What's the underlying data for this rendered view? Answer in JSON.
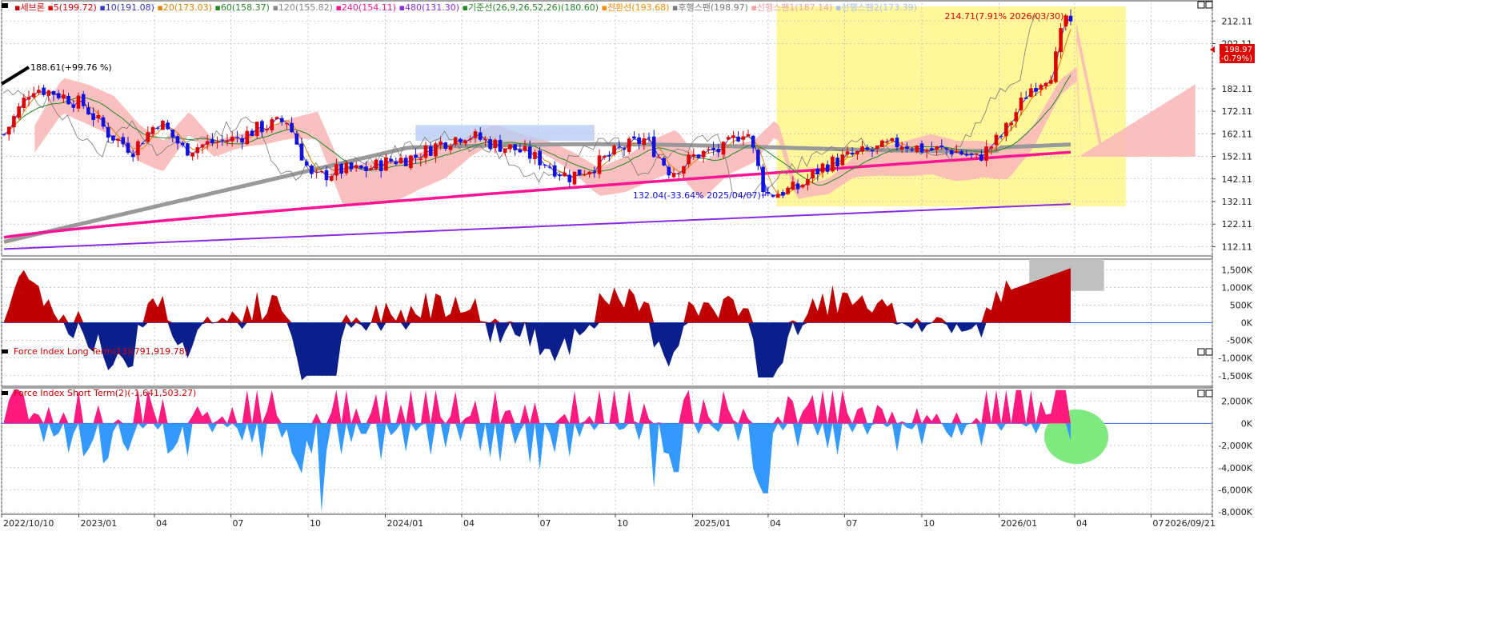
{
  "legend": {
    "items": [
      {
        "text": "세브론",
        "color": "#cc0000"
      },
      {
        "text": "5(199.72)",
        "color": "#e00000"
      },
      {
        "text": "10(191.08)",
        "color": "#3333cc"
      },
      {
        "text": "20(173.03)",
        "color": "#e08000"
      },
      {
        "text": "60(158.37)",
        "color": "#228822"
      },
      {
        "text": "120(155.82)",
        "color": "#888888"
      },
      {
        "text": "240(154.11)",
        "color": "#ff1493"
      },
      {
        "text": "480(131.30)",
        "color": "#8a2be2"
      },
      {
        "text": "기준선(26,9,26,52,26)(180.60)",
        "color": "#228822"
      },
      {
        "text": "전환선(193.68)",
        "color": "#ff8c00"
      },
      {
        "text": "후행스팬(198.97)",
        "color": "#777777"
      },
      {
        "text": "선행스팬1(187.14)",
        "color": "#f4a0a0"
      },
      {
        "text": "선행스팬2(173.39)",
        "color": "#a8c0f0"
      }
    ]
  },
  "price_panel": {
    "y_ticks": [
      "212.11",
      "202.11",
      "182.11",
      "172.11",
      "162.11",
      "152.11",
      "142.11",
      "132.11",
      "122.11",
      "112.11"
    ],
    "current_price": "198.97",
    "current_change": "(-0.79%)",
    "high_annotation": "214.71(7.91% 2026/03/30)",
    "low_annotation": "132.04(-33.64% 2025/04/07)",
    "left_annotation": "188.61(+99.76 %)"
  },
  "force_long": {
    "title": "Force Index Long Term(13)(791,919.78)",
    "y_ticks": [
      "1,500K",
      "1,000K",
      "500K",
      "0K",
      "-500K",
      "-1,000K",
      "-1,500K"
    ]
  },
  "force_short": {
    "title": "Force Index Short Term(2)(-1,641,503.27)",
    "y_ticks": [
      "2,000K",
      "0K",
      "-2,000K",
      "-4,000K",
      "-6,000K",
      "-8,000K"
    ]
  },
  "x_axis": {
    "labels": [
      "2022/10/10",
      "2023/01",
      "04",
      "07",
      "10",
      "2024/01",
      "04",
      "07",
      "10",
      "2025/01",
      "04",
      "07",
      "10",
      "2026/01",
      "04",
      "07",
      "2026/09/21"
    ]
  },
  "chart_data": {
    "type": "candlestick",
    "title": "세브론",
    "ylim": [
      108,
      220
    ],
    "date_range": [
      "2022/10/10",
      "2026/09/21"
    ],
    "price_keypoints": [
      {
        "date": "2022/10/10",
        "close": 160
      },
      {
        "date": "2022/11",
        "close": 183
      },
      {
        "date": "2022/12",
        "close": 180
      },
      {
        "date": "2023/01",
        "close": 175
      },
      {
        "date": "2023/02",
        "close": 162
      },
      {
        "date": "2023/03",
        "close": 155
      },
      {
        "date": "2023/04",
        "close": 168
      },
      {
        "date": "2023/05",
        "close": 155
      },
      {
        "date": "2023/06",
        "close": 158
      },
      {
        "date": "2023/07",
        "close": 160
      },
      {
        "date": "2023/08",
        "close": 165
      },
      {
        "date": "2023/09",
        "close": 168
      },
      {
        "date": "2023/10",
        "close": 142
      },
      {
        "date": "2023/11",
        "close": 146
      },
      {
        "date": "2023/12",
        "close": 146
      },
      {
        "date": "2024/01",
        "close": 150
      },
      {
        "date": "2024/02",
        "close": 152
      },
      {
        "date": "2024/03",
        "close": 158
      },
      {
        "date": "2024/04",
        "close": 162
      },
      {
        "date": "2024/05",
        "close": 158
      },
      {
        "date": "2024/06",
        "close": 155
      },
      {
        "date": "2024/07",
        "close": 150
      },
      {
        "date": "2024/08",
        "close": 143
      },
      {
        "date": "2024/09",
        "close": 148
      },
      {
        "date": "2024/10",
        "close": 155
      },
      {
        "date": "2024/11",
        "close": 160
      },
      {
        "date": "2024/12",
        "close": 145
      },
      {
        "date": "2025/01",
        "close": 153
      },
      {
        "date": "2025/02",
        "close": 155
      },
      {
        "date": "2025/03",
        "close": 165
      },
      {
        "date": "2025/04/07",
        "close": 135
      },
      {
        "date": "2025/05",
        "close": 138
      },
      {
        "date": "2025/06",
        "close": 148
      },
      {
        "date": "2025/07",
        "close": 152
      },
      {
        "date": "2025/08",
        "close": 155
      },
      {
        "date": "2025/09",
        "close": 158
      },
      {
        "date": "2025/10",
        "close": 155
      },
      {
        "date": "2025/11",
        "close": 155
      },
      {
        "date": "2025/12",
        "close": 151
      },
      {
        "date": "2026/01",
        "close": 162
      },
      {
        "date": "2026/02",
        "close": 182
      },
      {
        "date": "2026/03",
        "close": 190
      },
      {
        "date": "2026/03/30",
        "close": 214.71
      },
      {
        "date": "2026/04",
        "close": 198.97
      }
    ],
    "series": [
      {
        "name": "240(154.11)",
        "last": 154.11
      },
      {
        "name": "120(155.82)",
        "last": 155.82
      },
      {
        "name": "480(131.30)",
        "last": 131.3
      },
      {
        "name": "60(158.37)",
        "last": 158.37
      },
      {
        "name": "20(173.03)",
        "last": 173.03
      },
      {
        "name": "10(191.08)",
        "last": 191.08
      },
      {
        "name": "5(199.72)",
        "last": 199.72
      }
    ],
    "force_index_long_ylim": [
      -1800,
      1800
    ],
    "force_index_short_ylim": [
      -8200,
      3200
    ]
  },
  "colors": {
    "up": "#e00000",
    "down": "#1010e0",
    "highlight": "#fff79a",
    "cloud_up": "#f9b8b8",
    "cloud_down": "#b8cdf2",
    "fl_pos": "#c00000",
    "fl_neg": "#0a1f8c",
    "fs_pos": "#ff1a80",
    "fs_neg": "#3399ff"
  }
}
